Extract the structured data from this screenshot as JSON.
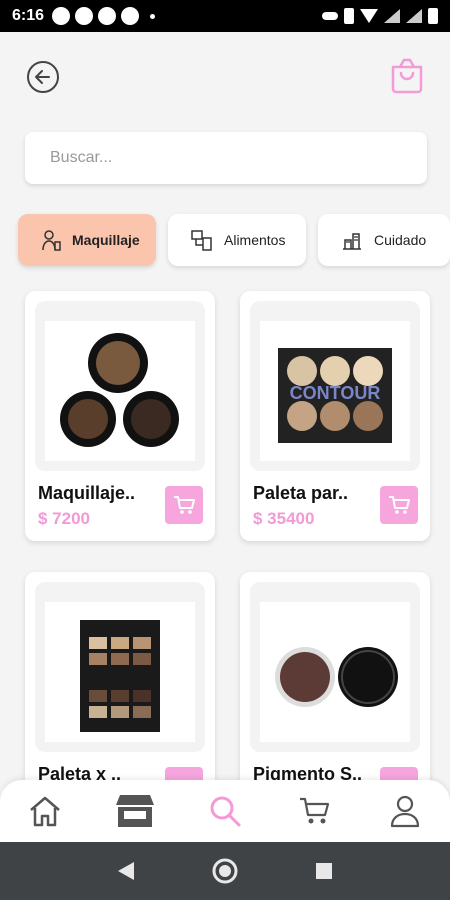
{
  "status_bar": {
    "time": "6:16"
  },
  "search": {
    "placeholder": "Buscar..."
  },
  "categories": [
    {
      "label": "Maquillaje",
      "active": true
    },
    {
      "label": "Alimentos",
      "active": false
    },
    {
      "label": "Cuidado",
      "active": false
    }
  ],
  "products": [
    {
      "name": "Maquillaje..",
      "price": "$ 7200"
    },
    {
      "name": "Paleta par..",
      "price": "$ 35400",
      "image_text": "CONTOUR"
    },
    {
      "name": "Paleta x ..",
      "price": ""
    },
    {
      "name": "Pigmento S..",
      "price": ""
    }
  ],
  "colors": {
    "accent": "#f6a6dd",
    "price": "#f29ad6",
    "active_category": "#fac4ad"
  },
  "bottom_nav": [
    "home-icon",
    "store-icon",
    "search-icon",
    "cart-icon",
    "profile-icon"
  ]
}
